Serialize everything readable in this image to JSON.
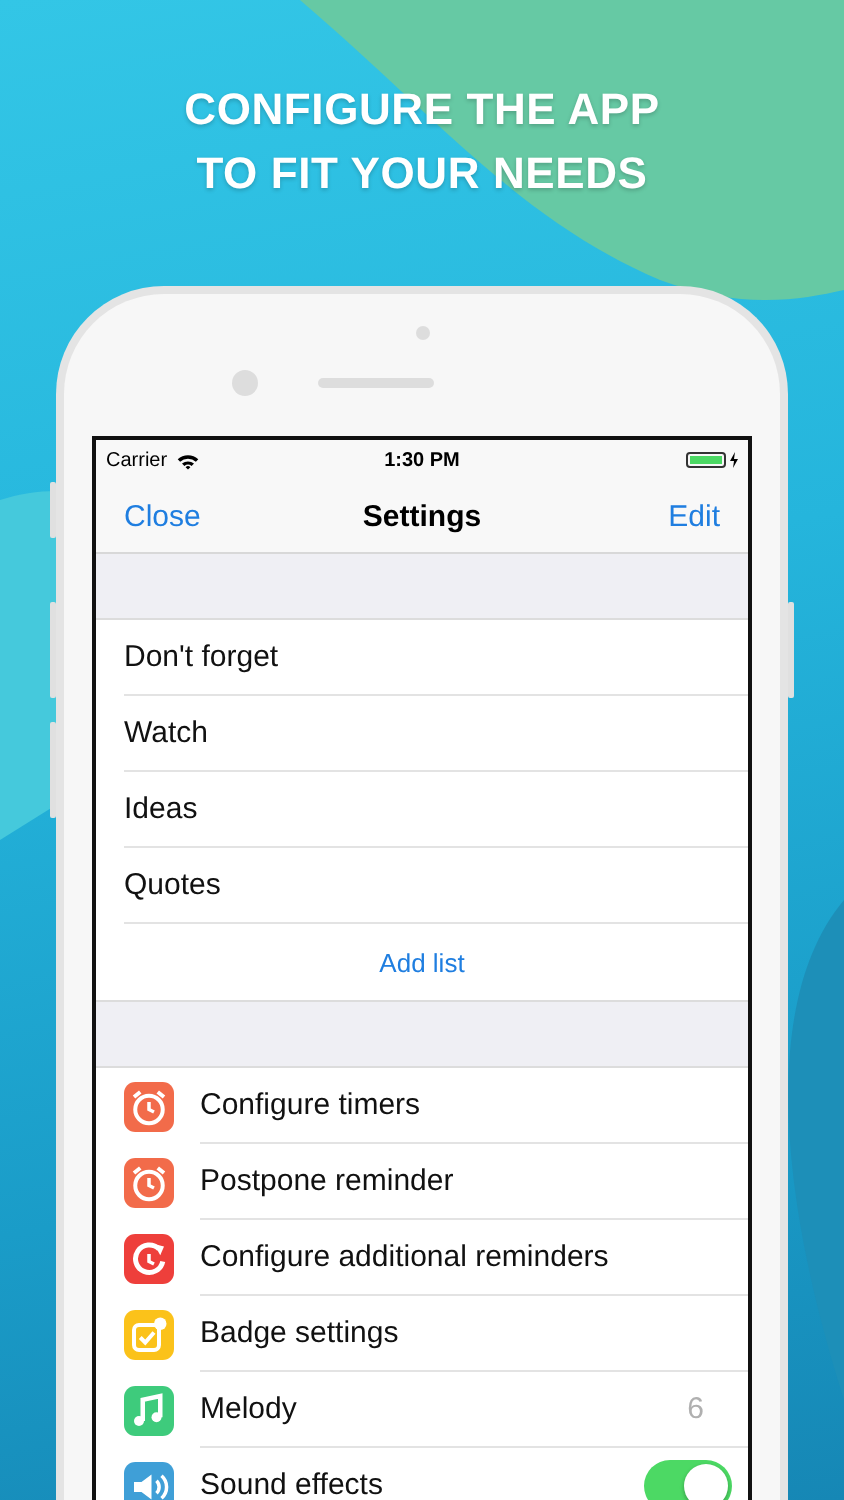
{
  "headline": [
    "CONFIGURE THE APP",
    "TO FIT YOUR NEEDS"
  ],
  "status_bar": {
    "carrier": "Carrier",
    "time": "1:30 PM"
  },
  "nav_bar": {
    "left": "Close",
    "title": "Settings",
    "right": "Edit"
  },
  "lists": [
    {
      "label": "Don't forget"
    },
    {
      "label": "Watch"
    },
    {
      "label": "Ideas"
    },
    {
      "label": "Quotes"
    }
  ],
  "add_list": "Add list",
  "settings": [
    {
      "kind": "link",
      "label": "Configure timers",
      "color": "#f26b4a"
    },
    {
      "kind": "link",
      "label": "Postpone reminder",
      "color": "#f26b4a"
    },
    {
      "kind": "link",
      "label": "Configure additional reminders",
      "color": "#ee3f3b"
    },
    {
      "kind": "link",
      "label": "Badge settings",
      "color": "#fbc21a"
    },
    {
      "kind": "value",
      "label": "Melody",
      "value": "6",
      "color": "#3ecb7c"
    },
    {
      "kind": "toggle",
      "label": "Sound effects",
      "on": true,
      "color": "#3f9fd7"
    }
  ]
}
